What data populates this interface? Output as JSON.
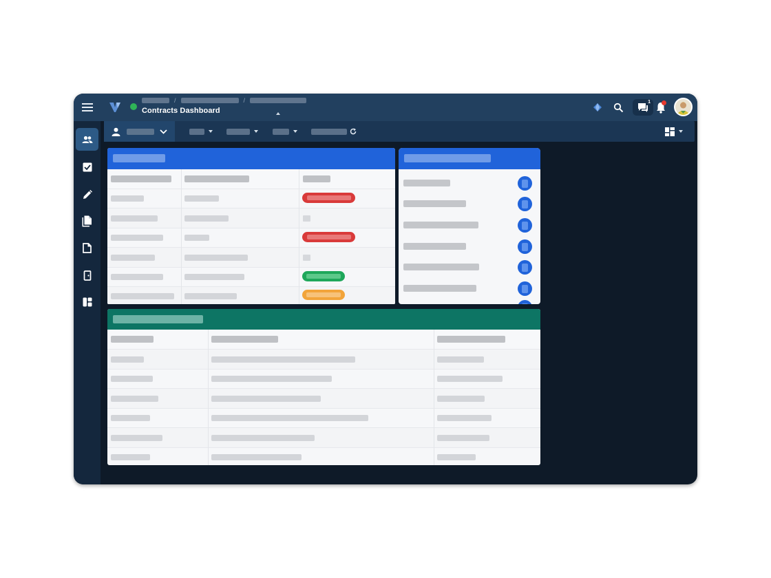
{
  "header": {
    "title": "Contracts Dashboard",
    "breadcrumb_separator": "/",
    "chat_count": "1"
  },
  "icons": {
    "menu": "hamburger-icon",
    "logo": "app-logo",
    "status": "online-status-dot",
    "premium": "diamond-icon",
    "search": "search-icon",
    "chat": "chat-icon",
    "notifications": "bell-icon",
    "user": "user-avatar"
  },
  "sidebar": {
    "items": [
      {
        "name": "people",
        "active": true
      },
      {
        "name": "tasks",
        "active": false
      },
      {
        "name": "edit",
        "active": false
      },
      {
        "name": "documents",
        "active": false
      },
      {
        "name": "file",
        "active": false
      },
      {
        "name": "exit",
        "active": false
      },
      {
        "name": "layout",
        "active": false
      }
    ]
  },
  "colors": {
    "panel_blue": "#2063da",
    "panel_teal": "#0d7564",
    "status_red": "#d93a3a",
    "status_green": "#1ea75a",
    "status_orange": "#f2a43a",
    "online": "#2fb457",
    "notification": "#e5392f"
  },
  "contracts_table": {
    "rows": [
      {
        "status": "red"
      },
      {
        "status": "none"
      },
      {
        "status": "red"
      },
      {
        "status": "none"
      },
      {
        "status": "green"
      },
      {
        "status": "orange"
      }
    ]
  }
}
